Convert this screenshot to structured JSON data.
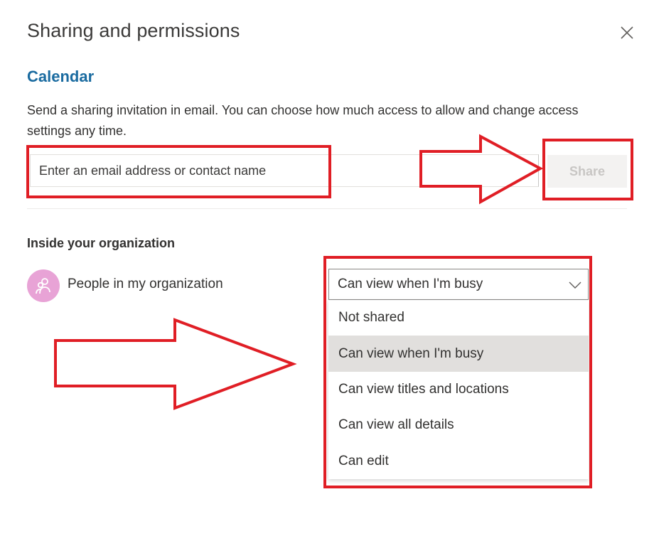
{
  "dialog": {
    "title": "Sharing and permissions",
    "close_icon": "close-icon"
  },
  "calendar": {
    "heading": "Calendar",
    "description": "Send a sharing invitation in email. You can choose how much access to allow and change access settings any time.",
    "email_placeholder": "Enter an email address or contact name",
    "email_value": "",
    "share_label": "Share"
  },
  "organization": {
    "heading": "Inside your organization",
    "person": {
      "icon": "group-icon",
      "label": "People in my organization",
      "avatar_color": "#e8a3d6"
    },
    "permission": {
      "selected": "Can view when I'm busy",
      "options": [
        "Not shared",
        "Can view when I'm busy",
        "Can view titles and locations",
        "Can view all details",
        "Can edit"
      ],
      "selected_index": 1
    }
  },
  "annotation_colors": {
    "highlight": "#e01e25",
    "accent": "#1a6ba0"
  }
}
